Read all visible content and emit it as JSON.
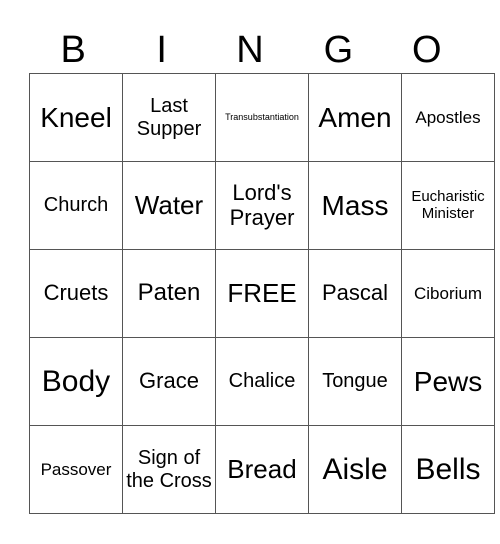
{
  "header": [
    "B",
    "I",
    "N",
    "G",
    "O"
  ],
  "rows": [
    [
      "Kneel",
      "Last Supper",
      "Transubstantiation",
      "Amen",
      "Apostles"
    ],
    [
      "Church",
      "Water",
      "Lord's Prayer",
      "Mass",
      "Eucharistic Minister"
    ],
    [
      "Cruets",
      "Paten",
      "FREE",
      "Pascal",
      "Ciborium"
    ],
    [
      "Body",
      "Grace",
      "Chalice",
      "Tongue",
      "Pews"
    ],
    [
      "Passover",
      "Sign of the Cross",
      "Bread",
      "Aisle",
      "Bells"
    ]
  ]
}
